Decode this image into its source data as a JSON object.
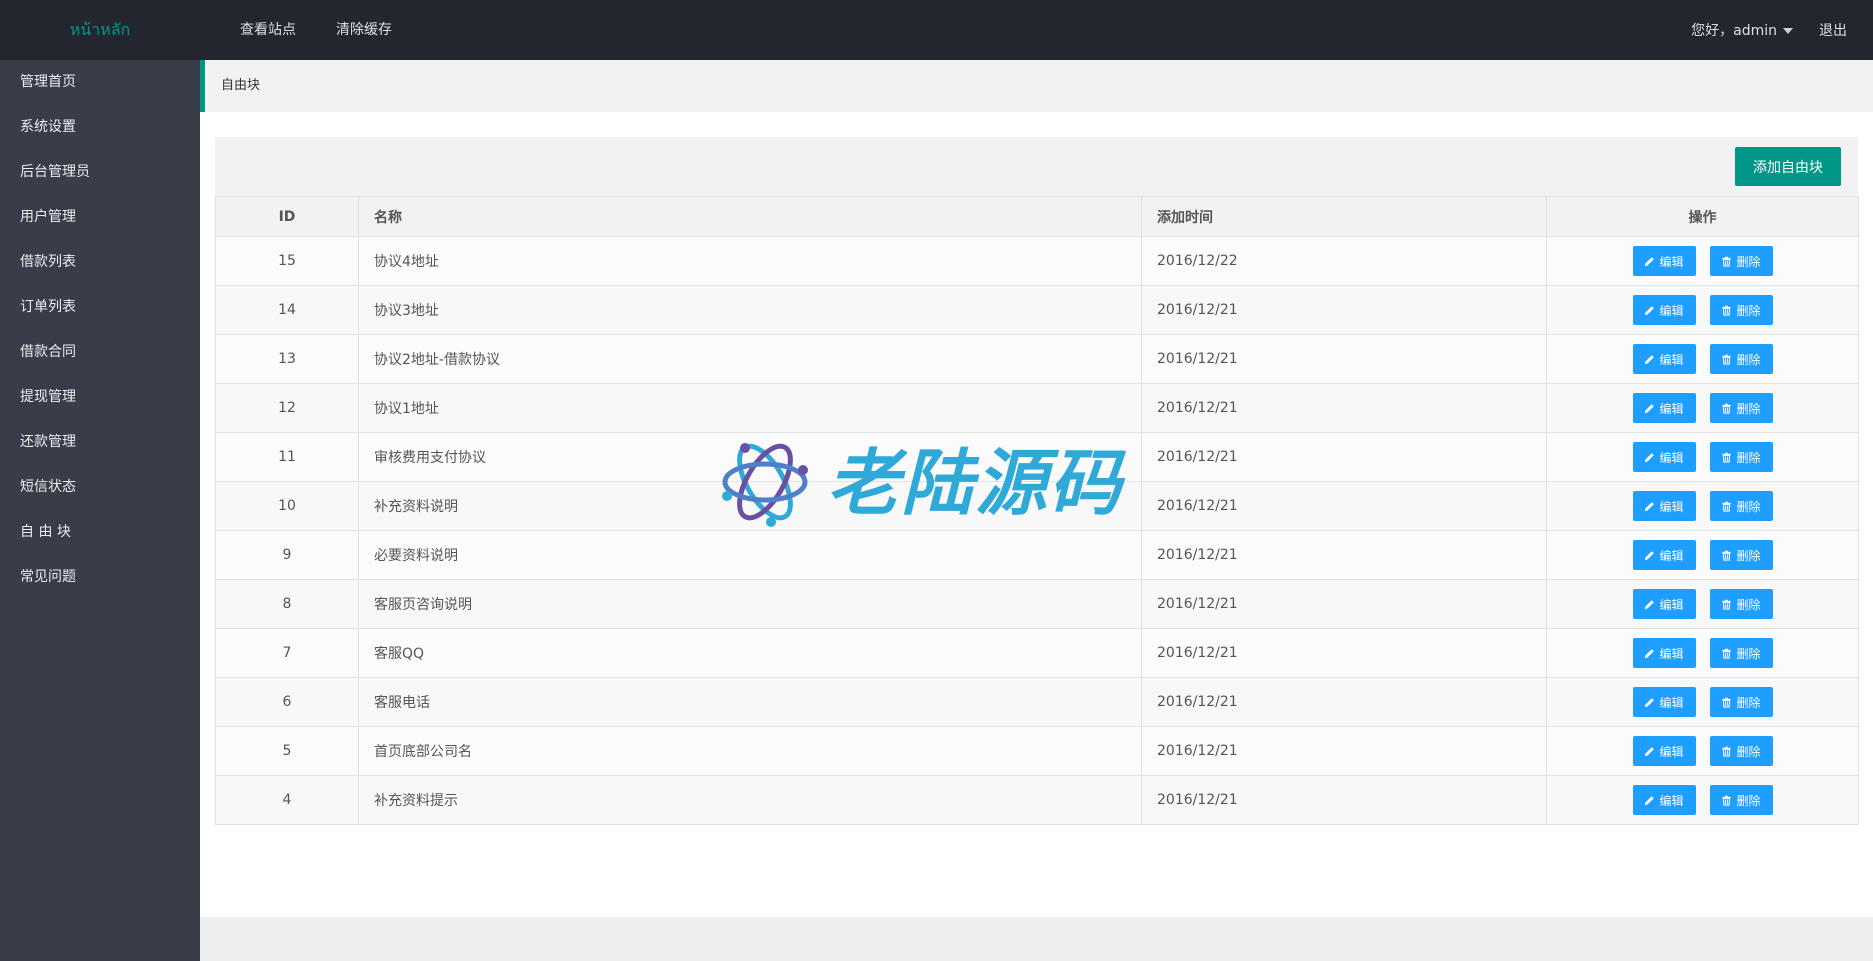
{
  "header": {
    "logo": "หน้าหลัก",
    "nav": [
      "查看站点",
      "清除缓存"
    ],
    "greeting": "您好，admin",
    "logout": "退出"
  },
  "sidebar": {
    "items": [
      "管理首页",
      "系统设置",
      "后台管理员",
      "用户管理",
      "借款列表",
      "订单列表",
      "借款合同",
      "提现管理",
      "还款管理",
      "短信状态",
      "自 由 块",
      "常见问题"
    ]
  },
  "breadcrumb": "自由块",
  "toolbar": {
    "add_label": "添加自由块"
  },
  "table": {
    "headers": [
      "ID",
      "名称",
      "添加时间",
      "操作"
    ],
    "edit_label": "编辑",
    "delete_label": "删除",
    "rows": [
      {
        "id": "15",
        "name": "协议4地址",
        "time": "2016/12/22"
      },
      {
        "id": "14",
        "name": "协议3地址",
        "time": "2016/12/21"
      },
      {
        "id": "13",
        "name": "协议2地址-借款协议",
        "time": "2016/12/21"
      },
      {
        "id": "12",
        "name": "协议1地址",
        "time": "2016/12/21"
      },
      {
        "id": "11",
        "name": "审核费用支付协议",
        "time": "2016/12/21"
      },
      {
        "id": "10",
        "name": "补充资料说明",
        "time": "2016/12/21"
      },
      {
        "id": "9",
        "name": "必要资料说明",
        "time": "2016/12/21"
      },
      {
        "id": "8",
        "name": "客服页咨询说明",
        "time": "2016/12/21"
      },
      {
        "id": "7",
        "name": "客服QQ",
        "time": "2016/12/21"
      },
      {
        "id": "6",
        "name": "客服电话",
        "time": "2016/12/21"
      },
      {
        "id": "5",
        "name": "首页底部公司名",
        "time": "2016/12/21"
      },
      {
        "id": "4",
        "name": "补充资料提示",
        "time": "2016/12/21"
      }
    ]
  },
  "watermark": {
    "text": "老陆源码",
    "icon": "atom-logo-icon"
  },
  "colors": {
    "header_bg": "#23262e",
    "sidebar_bg": "#393d49",
    "accent": "#009688",
    "button_blue": "#1e9fff"
  }
}
